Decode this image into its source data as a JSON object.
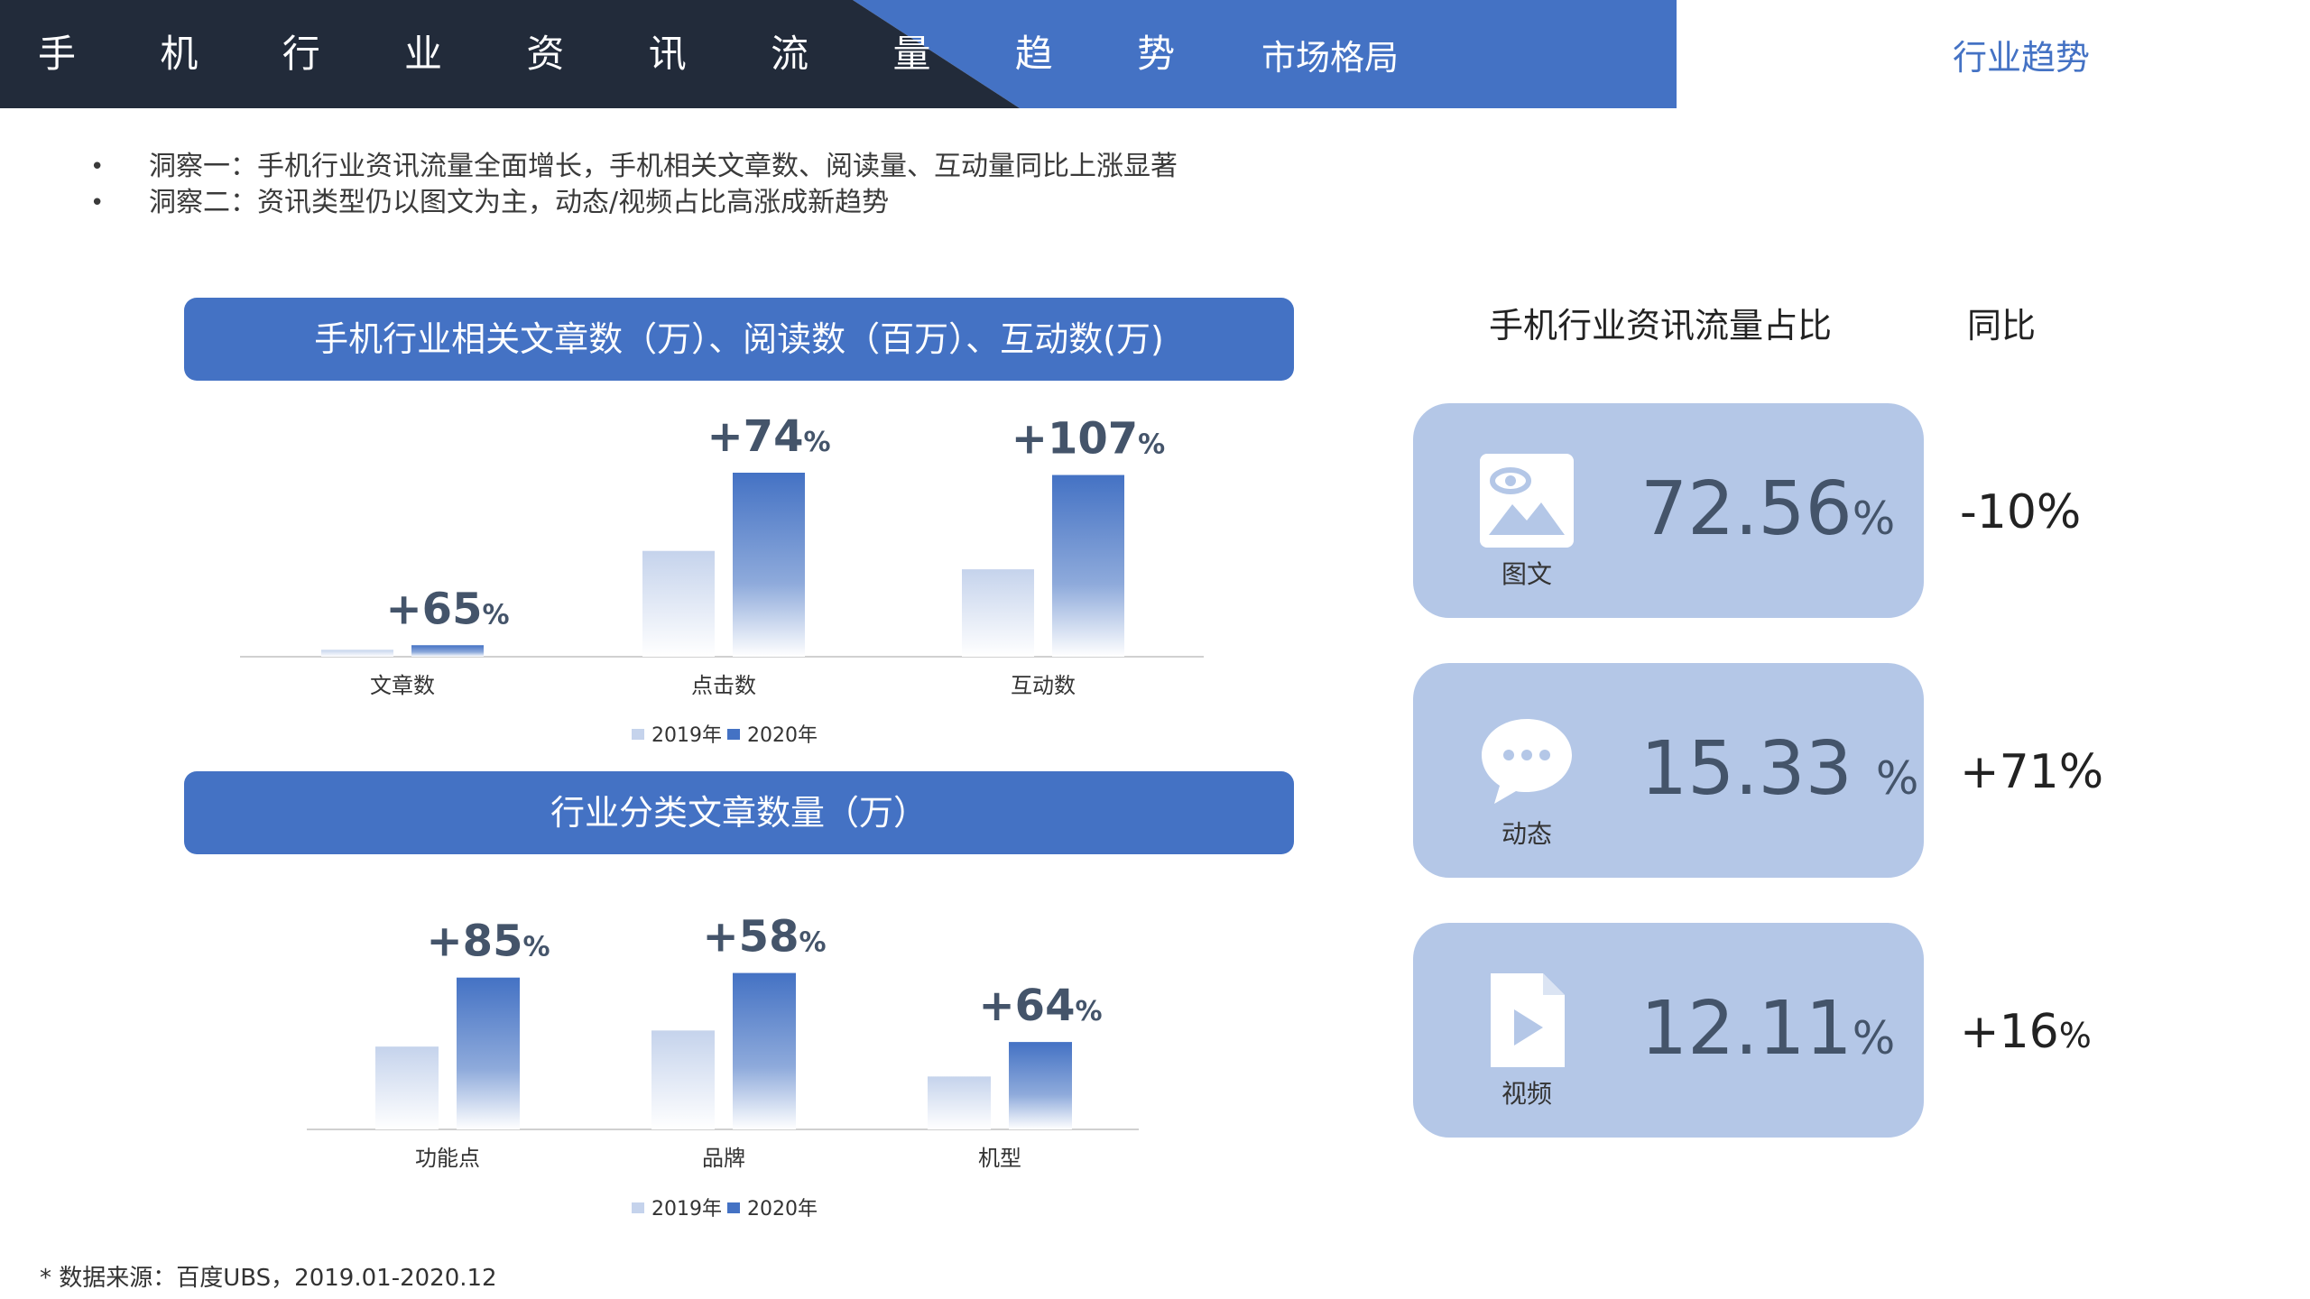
{
  "header": {
    "title": "手 机 行 业 资 讯 流 量 趋 势",
    "tabs": [
      {
        "label": "市场格局",
        "active": false
      },
      {
        "label": "行业趋势",
        "active": true
      }
    ]
  },
  "insights": [
    "洞察一：手机行业资讯流量全面增长，手机相关文章数、阅读量、互动量同比上涨显著",
    "洞察二：资讯类型仍以图文为主，动态/视频占比高涨成新趋势"
  ],
  "bullet": "•",
  "colors": {
    "accent": "#4472c4",
    "dark": "#222b3a",
    "bar2019": "#c5d3ec",
    "bar2020": "#4472c4",
    "card": "#b4c7e7"
  },
  "chart_data": [
    {
      "type": "bar",
      "title": "手机行业相关文章数（万）、阅读数（百万）、互动数(万)",
      "categories": [
        "文章数",
        "点击数",
        "互动数"
      ],
      "series": [
        {
          "name": "2019年",
          "values": [
            3,
            46,
            38
          ]
        },
        {
          "name": "2020年",
          "values": [
            5,
            80,
            79
          ]
        }
      ],
      "growth": [
        {
          "num": "+65",
          "unit": "%"
        },
        {
          "num": "+74",
          "unit": "%"
        },
        {
          "num": "+107",
          "unit": "%"
        }
      ],
      "ylim": [
        0,
        100
      ],
      "legend": "bottom"
    },
    {
      "type": "bar",
      "title": "行业分类文章数量（万）",
      "categories": [
        "功能点",
        "品牌",
        "机型"
      ],
      "series": [
        {
          "name": "2019年",
          "values": [
            36,
            43,
            23
          ]
        },
        {
          "name": "2020年",
          "values": [
            66,
            68,
            38
          ]
        }
      ],
      "growth": [
        {
          "num": "+85",
          "unit": "%"
        },
        {
          "num": "+58",
          "unit": "%"
        },
        {
          "num": "+64",
          "unit": "%"
        }
      ],
      "ylim": [
        0,
        100
      ],
      "legend": "bottom"
    }
  ],
  "share": {
    "title": "手机行业资讯流量占比",
    "yoy_title": "同比",
    "items": [
      {
        "label": "图文",
        "value": "72.56",
        "unit": "%",
        "yoy": "-10%",
        "yoy_unit": "",
        "icon": "image-icon"
      },
      {
        "label": "动态",
        "value": "15.33 ",
        "unit": "%",
        "yoy": "+71%",
        "yoy_unit": "",
        "icon": "chat-bubble-icon"
      },
      {
        "label": "视频",
        "value": "12.11",
        "unit": "%",
        "yoy": "+16",
        "yoy_unit": "%",
        "icon": "video-file-icon"
      }
    ]
  },
  "source": "* 数据来源：百度UBS，2019.01-2020.12"
}
